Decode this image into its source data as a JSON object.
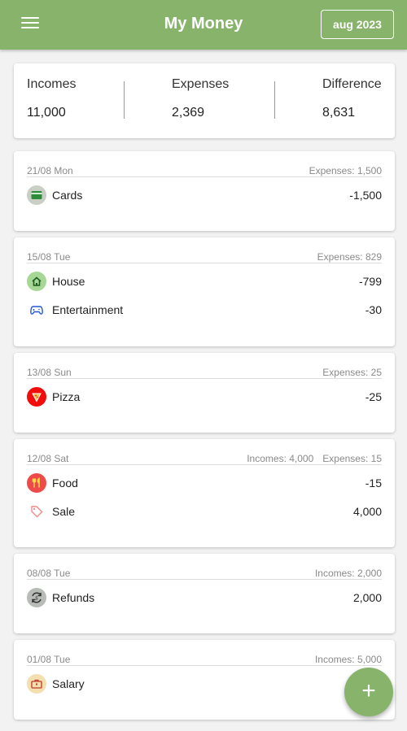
{
  "header": {
    "title": "My Money",
    "month": "aug 2023",
    "menu_icon": "hamburger-menu-icon"
  },
  "summary": {
    "incomes_label": "Incomes",
    "incomes_value": "11,000",
    "expenses_label": "Expenses",
    "expenses_value": "2,369",
    "difference_label": "Difference",
    "difference_value": "8,631"
  },
  "days": [
    {
      "date": "21/08 Mon",
      "totals": [
        "Expenses: 1,500"
      ],
      "items": [
        {
          "category": "Cards",
          "amount": "-1,500",
          "icon": "card-icon",
          "color": "#c9cfc4"
        }
      ]
    },
    {
      "date": "15/08 Tue",
      "totals": [
        "Expenses: 829"
      ],
      "items": [
        {
          "category": "House",
          "amount": "-799",
          "icon": "house-icon",
          "color": "#a7d796"
        },
        {
          "category": "Entertainment",
          "amount": "-30",
          "icon": "gamepad-icon",
          "color": "#ffffff"
        }
      ]
    },
    {
      "date": "13/08 Sun",
      "totals": [
        "Expenses: 25"
      ],
      "items": [
        {
          "category": "Pizza",
          "amount": "-25",
          "icon": "pizza-icon",
          "color": "#f20d0d"
        }
      ]
    },
    {
      "date": "12/08 Sat",
      "totals": [
        "Incomes: 4,000",
        "Expenses: 15"
      ],
      "items": [
        {
          "category": "Food",
          "amount": "-15",
          "icon": "fork-knife-icon",
          "color": "#ee4a4a"
        },
        {
          "category": "Sale",
          "amount": "4,000",
          "icon": "tag-icon",
          "color": "#ffffff"
        }
      ]
    },
    {
      "date": "08/08 Tue",
      "totals": [
        "Incomes: 2,000"
      ],
      "items": [
        {
          "category": "Refunds",
          "amount": "2,000",
          "icon": "refund-icon",
          "color": "#b8bcb6"
        }
      ]
    },
    {
      "date": "01/08 Tue",
      "totals": [
        "Incomes: 5,000"
      ],
      "items": [
        {
          "category": "Salary",
          "amount": "",
          "icon": "briefcase-icon",
          "color": "#f4dfae"
        }
      ]
    }
  ],
  "fab": {
    "label": "+",
    "icon": "plus-icon"
  }
}
